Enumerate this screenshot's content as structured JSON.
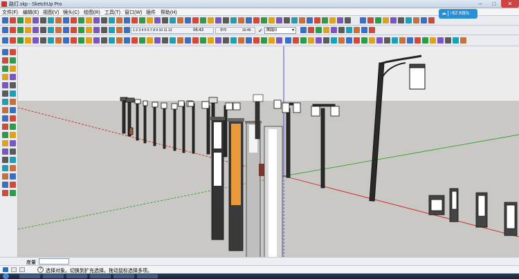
{
  "window": {
    "title": "路灯.skp - SketchUp Pro"
  },
  "network": {
    "speed": "62 KB/s"
  },
  "menu": {
    "items": [
      "文件(F)",
      "编辑(E)",
      "视图(V)",
      "镜头(C)",
      "绘图(R)",
      "工具(T)",
      "窗口(W)",
      "插件",
      "帮助(H)"
    ]
  },
  "shadow": {
    "months": "1 2 3 4 5 6 7 8 9 10 11 12",
    "time_start": "06:43",
    "time_mid": "中午",
    "time_end": "16:45"
  },
  "layer": {
    "check": "✓",
    "value": "图层0"
  },
  "measure": {
    "label": "度量"
  },
  "status": {
    "help_icon": "?",
    "text": "选择对象。切换到扩充选择。拖动鼠标选择多项。"
  },
  "colors": {
    "red_axis": "#cc2222",
    "green_axis": "#2ea32e",
    "blue_axis": "#3a3adc",
    "accent_orange": "#e89a3c",
    "netbadge": "#2b8fd8"
  }
}
